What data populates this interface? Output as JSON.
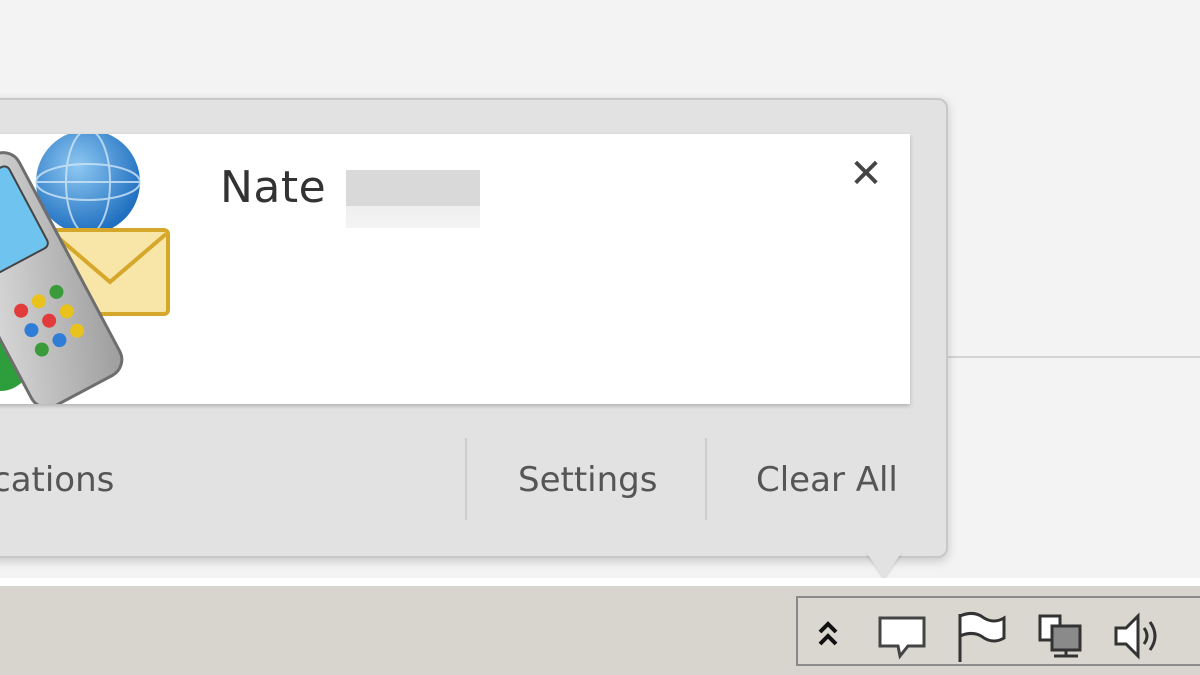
{
  "notification": {
    "sender_name": "Nate",
    "close_symbol": "✕"
  },
  "footer": {
    "notifications_label": "cations",
    "settings_label": "Settings",
    "clear_all_label": "Clear All"
  },
  "tray": {
    "icons": [
      "show-hidden-icons-icon",
      "action-center-icon",
      "flag-icon",
      "network-icon",
      "volume-icon"
    ],
    "chevron_symbol": "⌃"
  },
  "colors": {
    "popup_bg": "#e2e2e2",
    "card_bg": "#ffffff",
    "taskbar_bg": "#d8d5ce"
  }
}
